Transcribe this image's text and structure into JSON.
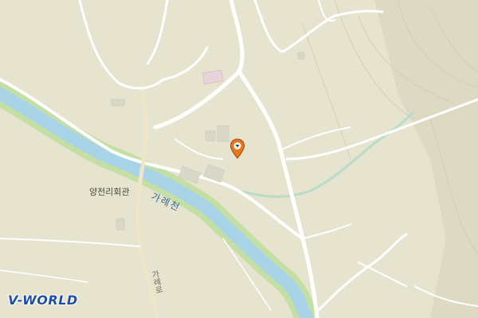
{
  "map": {
    "place_label": "양전리회관",
    "river_label": "가례천",
    "road_label": "가례로",
    "logo_text": "V-WORLD",
    "marker_icon": "map-pin-icon",
    "colors": {
      "land": "#e6e3cf",
      "road": "#ffffff",
      "river": "#a9d3e6",
      "river_bank": "#c4dfa3",
      "building": "#d9d7c8",
      "marker": "#e8761d",
      "logo": "#1f4ea6"
    }
  }
}
